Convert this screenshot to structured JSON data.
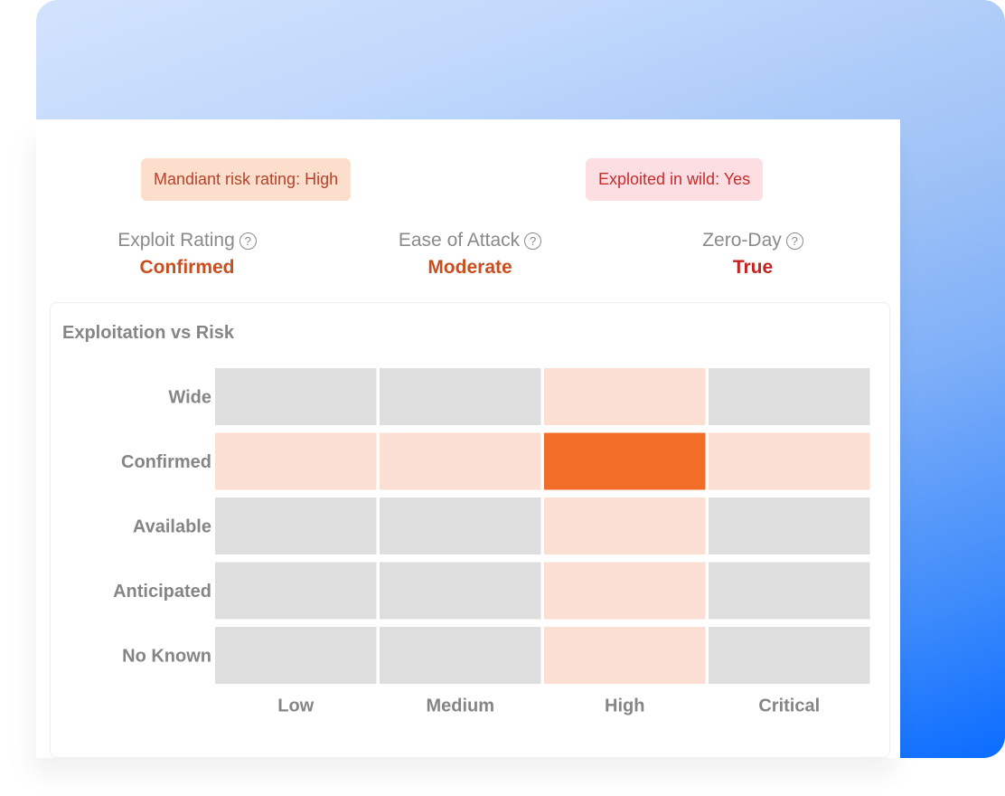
{
  "badges": {
    "risk_rating": "Mandiant risk rating: High",
    "exploited_in_wild": "Exploited in wild: Yes"
  },
  "stats": [
    {
      "label": "Exploit Rating",
      "value": "Confirmed",
      "icon": "help-circle-icon"
    },
    {
      "label": "Ease of Attack",
      "value": "Moderate",
      "icon": "help-circle-icon"
    },
    {
      "label": "Zero-Day",
      "value": "True",
      "icon": "help-circle-icon"
    }
  ],
  "help_glyph": "?",
  "colors": {
    "risk_badge_bg": "#fbdfcc",
    "risk_badge_text": "#b5432b",
    "wild_badge_bg": "#fddfe3",
    "wild_badge_text": "#c52c2c",
    "highlight": "#f26d28",
    "light_highlight": "#fbdfd2",
    "neutral": "#dedede"
  },
  "chart_data": {
    "type": "heatmap",
    "title": "Exploitation vs Risk",
    "xlabel": "",
    "ylabel": "",
    "x_categories": [
      "Low",
      "Medium",
      "High",
      "Critical"
    ],
    "y_categories": [
      "Wide",
      "Confirmed",
      "Available",
      "Anticipated",
      "No Known"
    ],
    "legend": "none",
    "grid": false,
    "levels": {
      "0": "neutral",
      "1": "related",
      "2": "selected"
    },
    "values": [
      [
        0,
        0,
        1,
        0
      ],
      [
        1,
        1,
        2,
        1
      ],
      [
        0,
        0,
        1,
        0
      ],
      [
        0,
        0,
        1,
        0
      ],
      [
        0,
        0,
        1,
        0
      ]
    ],
    "selected": {
      "x": "High",
      "y": "Confirmed"
    }
  }
}
